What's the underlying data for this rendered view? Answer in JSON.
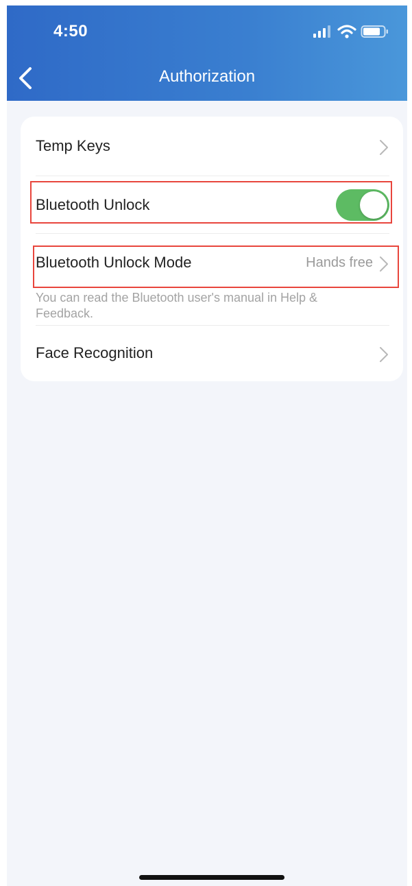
{
  "status_bar": {
    "time": "4:50",
    "icons": [
      "signal-icon",
      "wifi-icon",
      "battery-icon"
    ]
  },
  "nav": {
    "title": "Authorization",
    "back_icon": "chevron-left-icon"
  },
  "settings": {
    "temp_keys": {
      "label": "Temp Keys"
    },
    "bluetooth_unlock": {
      "label": "Bluetooth Unlock",
      "enabled": true
    },
    "bluetooth_unlock_mode": {
      "label": "Bluetooth Unlock Mode",
      "value": "Hands free",
      "hint": "You can read the Bluetooth user's manual in Help & Feedback."
    },
    "face_recognition": {
      "label": "Face Recognition"
    }
  },
  "colors": {
    "header_gradient_start": "#2f6ac7",
    "header_gradient_end": "#4a97da",
    "toggle_on": "#5dbb63",
    "highlight": "#e8453c",
    "background": "#f3f5fa"
  }
}
